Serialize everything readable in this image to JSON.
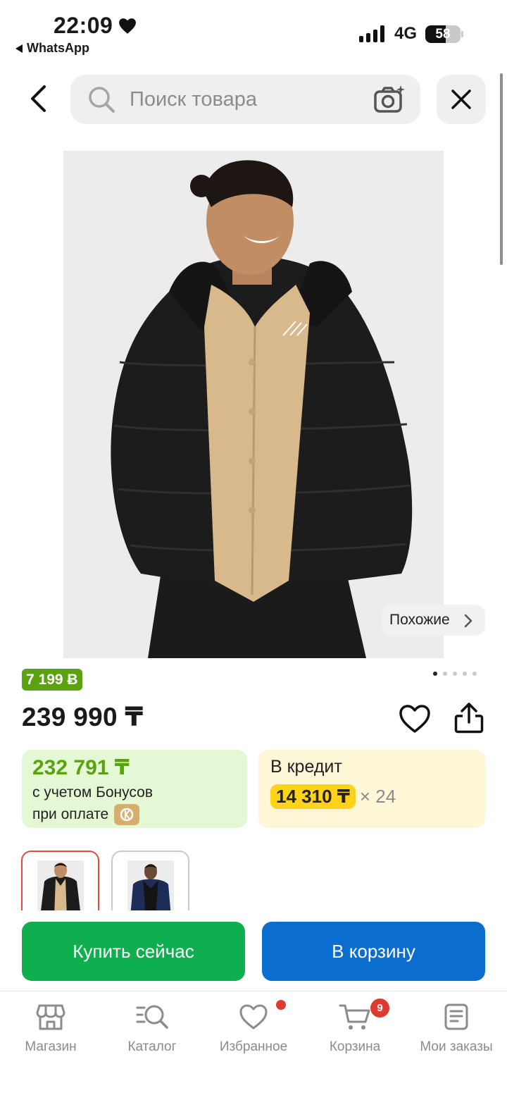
{
  "status_bar": {
    "time": "22:09",
    "back_app": "WhatsApp",
    "network": "4G",
    "battery_level": "58"
  },
  "search": {
    "placeholder": "Поиск товара"
  },
  "product": {
    "similar_label": "Похожие",
    "bonus_badge": "7 199 Ƀ",
    "price": "239 990 ₸",
    "image_count": 5,
    "active_image": 1,
    "bonus_price": {
      "value": "232 791 ₸",
      "line1": "с учетом Бонусов",
      "line2": "при оплате"
    },
    "credit": {
      "title": "В кредит",
      "monthly": "14 310 ₸",
      "months": "× 24"
    },
    "variants": [
      {
        "color": "black",
        "selected": true
      },
      {
        "color": "navy",
        "selected": false
      }
    ]
  },
  "actions": {
    "buy_now": "Купить сейчас",
    "add_to_cart": "В корзину"
  },
  "tabbar": {
    "items": [
      {
        "label": "Магазин",
        "icon": "store-icon"
      },
      {
        "label": "Каталог",
        "icon": "catalog-search-icon"
      },
      {
        "label": "Избранное",
        "icon": "heart-icon",
        "has_dot": true
      },
      {
        "label": "Корзина",
        "icon": "cart-icon",
        "badge": "9"
      },
      {
        "label": "Мои заказы",
        "icon": "orders-icon"
      }
    ]
  },
  "colors": {
    "bonus_green": "#5aa20f",
    "buy_green": "#0fae4f",
    "cart_blue": "#0b6ecf",
    "credit_yellow": "#ffd21c",
    "badge_red": "#e0392d"
  }
}
